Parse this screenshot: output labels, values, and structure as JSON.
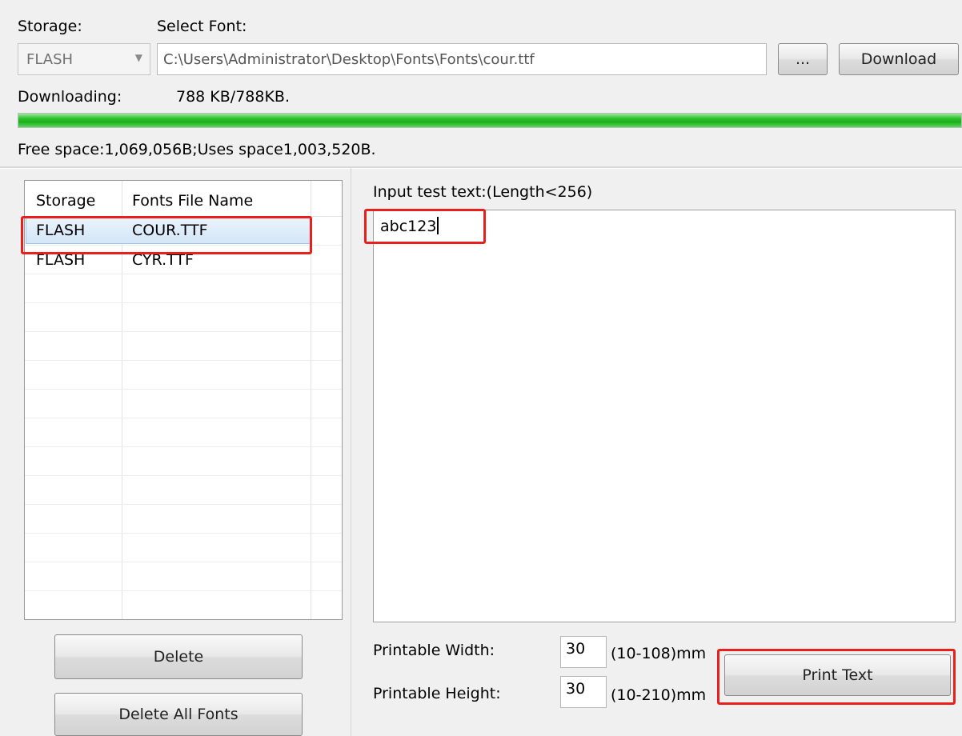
{
  "header": {
    "storage_label": "Storage:",
    "select_font_label": "Select Font:",
    "storage_value": "FLASH",
    "font_path": "C:\\Users\\Administrator\\Desktop\\Fonts\\Fonts\\cour.ttf",
    "browse_label": "...",
    "download_label": "Download"
  },
  "download": {
    "label": "Downloading:",
    "status": "788 KB/788KB.",
    "progress": 1.0,
    "free_space": "Free space:1,069,056B;Uses space1,003,520B."
  },
  "fonts_list": {
    "columns": [
      "Storage",
      "Fonts File Name"
    ],
    "rows": [
      {
        "storage": "FLASH",
        "name": "COUR.TTF",
        "selected": true
      },
      {
        "storage": "FLASH",
        "name": "CYR.TTF",
        "selected": false
      }
    ]
  },
  "left_buttons": {
    "delete": "Delete",
    "delete_all": "Delete All Fonts"
  },
  "test": {
    "input_label": "Input test text:(Length<256)",
    "text": "abc123",
    "width_label": "Printable Width:",
    "width_value": "30",
    "width_range": "(10-108)mm",
    "height_label": "Printable Height:",
    "height_value": "30",
    "height_range": "(10-210)mm",
    "print_label": "Print Text"
  },
  "colors": {
    "highlight": "#e8201c",
    "progress": "#19b019"
  }
}
